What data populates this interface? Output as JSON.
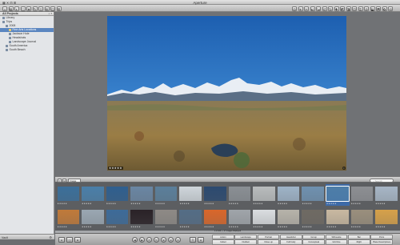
{
  "app": {
    "title": "Aperture",
    "menu": "▦ ✕ ⊟ ⊞"
  },
  "sidebar": {
    "header": "All Projects",
    "header_controls": "⌕ ▾",
    "items": [
      {
        "label": "Library",
        "indent": 0
      },
      {
        "label": "Trips",
        "indent": 0
      },
      {
        "label": "2008",
        "indent": 1
      },
      {
        "label": "Fine Arts Locations",
        "indent": 2,
        "selected": true
      },
      {
        "label": "Jackson Hole",
        "indent": 2
      },
      {
        "label": "Headshots",
        "indent": 2
      },
      {
        "label": "Landscape Journal",
        "indent": 2
      },
      {
        "label": "South America",
        "indent": 1
      },
      {
        "label": "South Beach",
        "indent": 1
      }
    ],
    "footer_label": "Vault",
    "footer_gear": "⚙"
  },
  "toolbar": {
    "left": [
      "⌂",
      "▤",
      "◐",
      "⬚",
      "★",
      "✎",
      "⇧",
      "⊕",
      "◫",
      "⊞"
    ],
    "right": [
      "◎",
      "⌖",
      "✂",
      "⤾",
      "⤿",
      "↺",
      "↻",
      "✚",
      "◩",
      "◨",
      "⊡",
      "⌗",
      "⊘",
      "⬓",
      "⬒",
      "✿",
      "⟲"
    ]
  },
  "viewer": {
    "rating": "★★★★★",
    "info": "i"
  },
  "browser_bar": {
    "view_buttons": [
      "≡",
      "⊞"
    ],
    "sort_select": "Image Date",
    "search_placeholder": "⌕ Search"
  },
  "browser": {
    "rows": [
      [
        "#3b6f9a",
        "#4a7fa9",
        "#2f5f8f",
        "#6a86a3",
        "#5b7f9b",
        "#cfd6db",
        "#2c4a70",
        "#8a8f94",
        "#b9bcbd",
        "#9eb3c7",
        "#6f91b0",
        "#4e7ea8",
        "#8d8f93",
        "#a7b6c6"
      ],
      [
        "#c07a3a",
        "#9aa7b2",
        "#3d6b99",
        "#2a2227",
        "#8e8a86",
        "#546d86",
        "#d9672b",
        "#a0a5aa",
        "#dadde0",
        "#b7b3aa",
        "#6f6a63",
        "#c9b9a1",
        "#9a8f7d",
        "#d6a14a"
      ]
    ],
    "selected_index": 11,
    "stars": "★★★★★",
    "statusline": "1 of 400 — 17 Images Displayed"
  },
  "bottom": {
    "left_buttons": [
      "⊟",
      "◫",
      "⊞"
    ],
    "nav_buttons": [
      "◀",
      "▶",
      "↺",
      "↻",
      "⊕",
      "⊖",
      "⊙"
    ],
    "mode_buttons": [
      "☰",
      "⊟"
    ],
    "keywords": [
      "Action",
      "Landscape",
      "Portrait",
      "Headshot",
      "Group",
      "Silhouette",
      "Bar",
      "Ports",
      "Indoor",
      "Outdoor",
      "Close up",
      "Full body",
      "Conceptual",
      "Grid line",
      "Right",
      "Place Descriptions"
    ]
  }
}
